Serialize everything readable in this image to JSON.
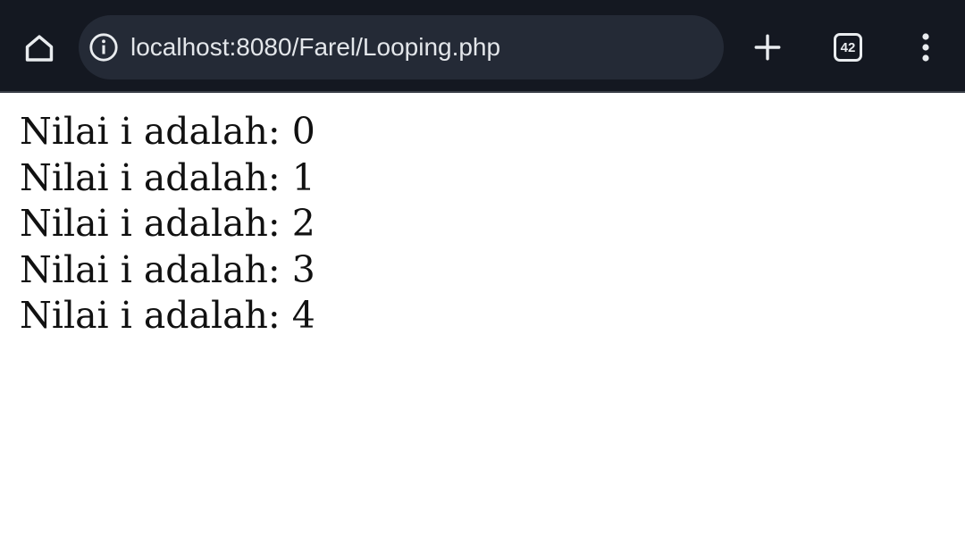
{
  "browser": {
    "url": "localhost:8080/Farel/Looping.php",
    "tab_count": "42",
    "icons": {
      "home": "home-icon",
      "info": "info-icon",
      "new_tab": "plus-icon",
      "tabs": "tab-switcher-icon",
      "menu": "kebab-menu-icon"
    },
    "colors": {
      "toolbar_bg": "#141821",
      "omnibox_bg": "#242a36",
      "icon": "#e9ecef"
    }
  },
  "page": {
    "lines": [
      "Nilai i adalah: 0",
      "Nilai i adalah: 1",
      "Nilai i adalah: 2",
      "Nilai i adalah: 3",
      "Nilai i adalah: 4"
    ]
  }
}
